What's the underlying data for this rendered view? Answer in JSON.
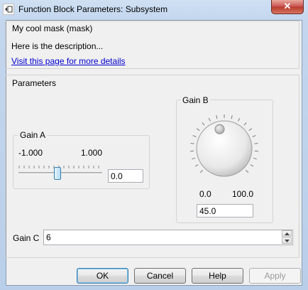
{
  "window": {
    "title": "Function Block Parameters: Subsystem",
    "close_label": "✕"
  },
  "mask": {
    "title": "My cool mask (mask)",
    "description": "Here is the description...",
    "link_text": "Visit this page for more details"
  },
  "parameters": {
    "title": "Parameters",
    "gain_a": {
      "label": "Gain A",
      "min_label": "-1.000",
      "max_label": "1.000",
      "min": -1.0,
      "max": 1.0,
      "value": 0.0,
      "input_value": "0.0",
      "slider_icon": "slider-thumb"
    },
    "gain_b": {
      "label": "Gain B",
      "min_label": "0.0",
      "max_label": "100.0",
      "min": 0.0,
      "max": 100.0,
      "value": 45.0,
      "input_value": "45.0",
      "knob_icon": "rotary-knob"
    },
    "gain_c": {
      "label": "Gain C",
      "input_value": "6"
    }
  },
  "buttons": {
    "ok": "OK",
    "cancel": "Cancel",
    "help": "Help",
    "apply": "Apply"
  },
  "colors": {
    "link": "#0000d0",
    "focus_border": "#3c7fb1",
    "disabled_text": "#9a9a9a"
  }
}
